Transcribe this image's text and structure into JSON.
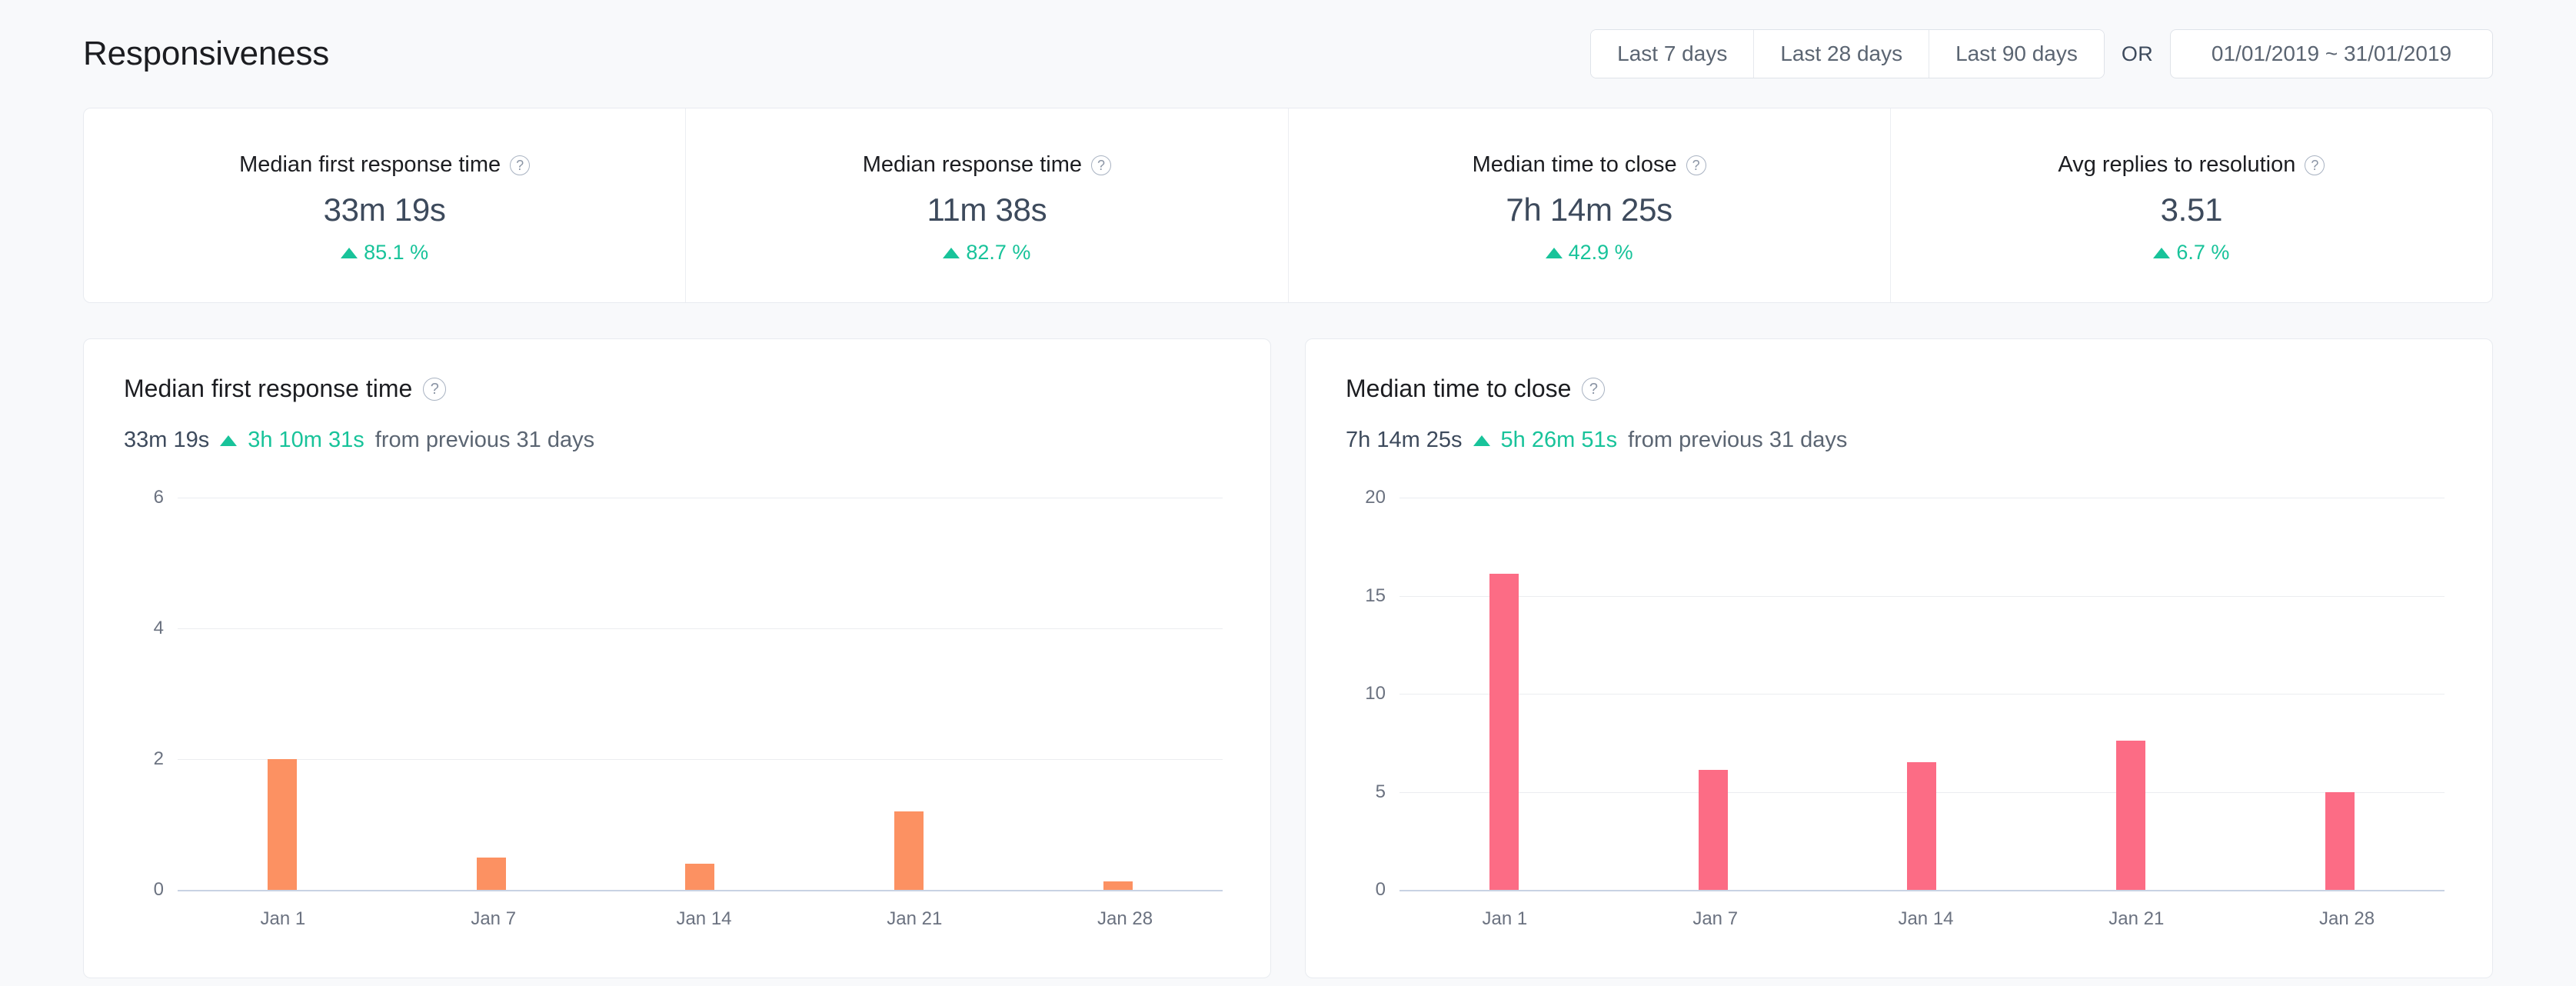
{
  "header": {
    "title": "Responsiveness",
    "or_label": "OR",
    "range_buttons": [
      {
        "label": "Last 7 days"
      },
      {
        "label": "Last 28 days"
      },
      {
        "label": "Last 90 days"
      }
    ],
    "date_range_value": "01/01/2019 ~ 31/01/2019"
  },
  "colors": {
    "accent_green": "#18c39a",
    "bar_orange": "#fc9162",
    "bar_pink": "#fc6c85",
    "text_dark": "#3d4a5c",
    "page_bg": "#f8f9fb"
  },
  "kpis": [
    {
      "label": "Median first response time",
      "value": "33m 19s",
      "delta": "85.1 %",
      "trend": "up",
      "help_icon": "question-circle-icon"
    },
    {
      "label": "Median response time",
      "value": "11m 38s",
      "delta": "82.7 %",
      "trend": "up",
      "help_icon": "question-circle-icon"
    },
    {
      "label": "Median time to close",
      "value": "7h 14m 25s",
      "delta": "42.9 %",
      "trend": "up",
      "help_icon": "question-circle-icon"
    },
    {
      "label": "Avg replies to resolution",
      "value": "3.51",
      "delta": "6.7 %",
      "trend": "up",
      "help_icon": "question-circle-icon"
    }
  ],
  "charts": [
    {
      "title": "Median first response time",
      "help_icon": "question-circle-icon",
      "summary_value": "33m 19s",
      "summary_delta": "3h 10m 31s",
      "summary_suffix": "from previous 31 days",
      "trend": "up"
    },
    {
      "title": "Median time to close",
      "help_icon": "question-circle-icon",
      "summary_value": "7h 14m 25s",
      "summary_delta": "5h 26m 51s",
      "summary_suffix": "from previous 31 days",
      "trend": "up"
    }
  ],
  "chart_data": [
    {
      "type": "bar",
      "title": "Median first response time",
      "xlabel": "",
      "ylabel": "",
      "categories": [
        "Jan 1",
        "Jan 7",
        "Jan 14",
        "Jan 21",
        "Jan 28"
      ],
      "values": [
        2.0,
        0.5,
        0.4,
        1.2,
        0.13
      ],
      "ylim": [
        0,
        6
      ],
      "yticks": [
        0,
        2,
        4,
        6
      ],
      "grid": true,
      "legend": "none",
      "color": "#fc9162"
    },
    {
      "type": "bar",
      "title": "Median time to close",
      "xlabel": "",
      "ylabel": "",
      "categories": [
        "Jan 1",
        "Jan 7",
        "Jan 14",
        "Jan 21",
        "Jan 28"
      ],
      "values": [
        16.1,
        6.1,
        6.5,
        7.6,
        5.0
      ],
      "ylim": [
        0,
        20
      ],
      "yticks": [
        0,
        5,
        10,
        15,
        20
      ],
      "grid": true,
      "legend": "none",
      "color": "#fc6c85"
    }
  ]
}
